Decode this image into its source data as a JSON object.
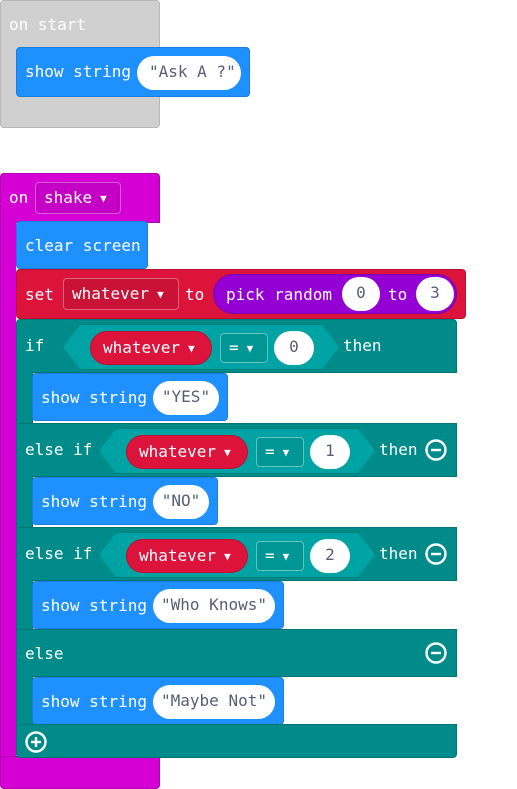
{
  "on_start": {
    "label": "on start",
    "show_string": {
      "label": "show string",
      "value": "\"Ask A ?\""
    }
  },
  "on_shake": {
    "label": "on",
    "event": "shake",
    "clear_screen": "clear screen",
    "set": {
      "label": "set",
      "variable": "whatever",
      "to_label": "to",
      "pick_random_label": "pick random",
      "from": "0",
      "to_word": "to",
      "to": "3"
    },
    "if": {
      "label": "if",
      "variable": "whatever",
      "operator": "=",
      "value": "0",
      "then_label": "then",
      "show_string": {
        "label": "show string",
        "value": "\"YES\""
      }
    },
    "else_if_1": {
      "label": "else if",
      "variable": "whatever",
      "operator": "=",
      "value": "1",
      "then_label": "then",
      "show_string": {
        "label": "show string",
        "value": "\"NO\""
      }
    },
    "else_if_2": {
      "label": "else if",
      "variable": "whatever",
      "operator": "=",
      "value": "2",
      "then_label": "then",
      "show_string": {
        "label": "show string",
        "value": "\"Who Knows\""
      }
    },
    "else": {
      "label": "else",
      "show_string": {
        "label": "show string",
        "value": "\"Maybe Not\""
      }
    }
  },
  "colors": {
    "basic": "#1e90ff",
    "variables": "#dc143c",
    "logic": "#008b8b",
    "math": "#9400d3",
    "input": "#d400d4",
    "disabled": "#d0d0d0"
  }
}
